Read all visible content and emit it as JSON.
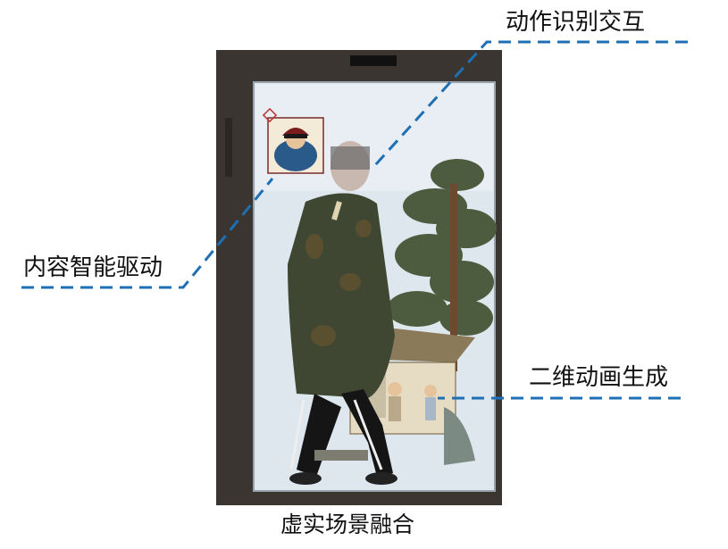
{
  "labels": {
    "top_right": "动作识别交互",
    "left": "内容智能驱动",
    "right": "二维动画生成",
    "bottom": "虚实场景融合"
  },
  "colors": {
    "line": "#1f6fb5",
    "frame": "#3a3530",
    "screen": "#dfe7ee"
  },
  "icons": [
    "portrait-icon",
    "chinese-knot-icon"
  ]
}
